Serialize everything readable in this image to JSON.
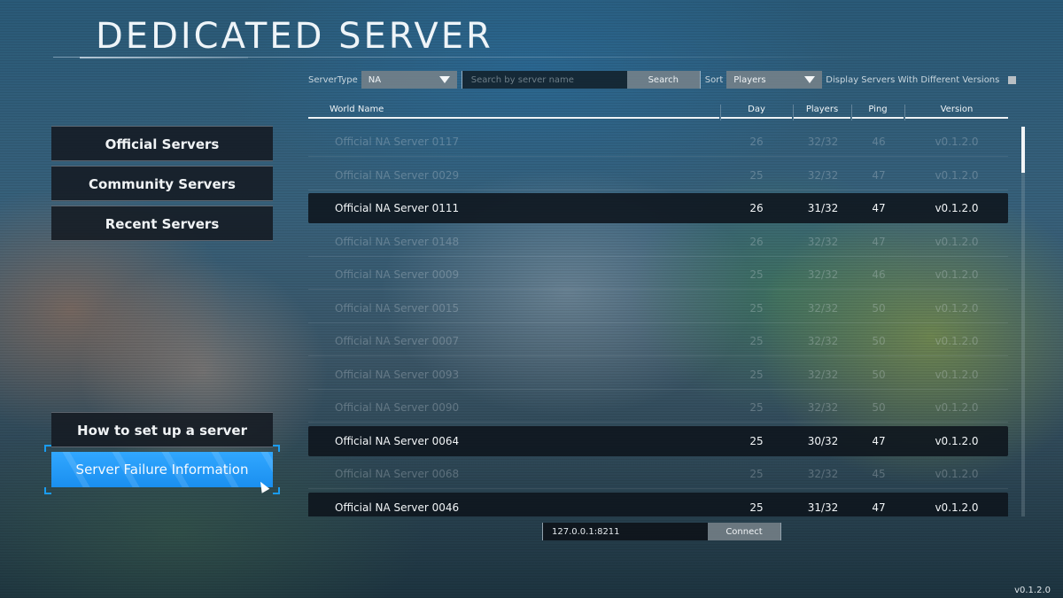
{
  "header": {
    "title": "DEDICATED SERVER"
  },
  "filters": {
    "server_type_label": "ServerType",
    "server_type_value": "NA",
    "search_placeholder": "Search by server name",
    "search_value": "",
    "search_button": "Search",
    "sort_label": "Sort",
    "sort_value": "Players",
    "different_versions_label": "Display Servers With Different Versions",
    "different_versions_checked": false
  },
  "table": {
    "columns": [
      "World Name",
      "Day",
      "Players",
      "Ping",
      "Version"
    ],
    "rows": [
      {
        "name": "Official NA Server 0117",
        "day": "26",
        "players": "32/32",
        "ping": "46",
        "version": "v0.1.2.0",
        "available": false
      },
      {
        "name": "Official NA Server 0029",
        "day": "25",
        "players": "32/32",
        "ping": "47",
        "version": "v0.1.2.0",
        "available": false
      },
      {
        "name": "Official NA Server 0111",
        "day": "26",
        "players": "31/32",
        "ping": "47",
        "version": "v0.1.2.0",
        "available": true
      },
      {
        "name": "Official NA Server 0148",
        "day": "26",
        "players": "32/32",
        "ping": "47",
        "version": "v0.1.2.0",
        "available": false
      },
      {
        "name": "Official NA Server 0009",
        "day": "25",
        "players": "32/32",
        "ping": "46",
        "version": "v0.1.2.0",
        "available": false
      },
      {
        "name": "Official NA Server 0015",
        "day": "25",
        "players": "32/32",
        "ping": "50",
        "version": "v0.1.2.0",
        "available": false
      },
      {
        "name": "Official NA Server 0007",
        "day": "25",
        "players": "32/32",
        "ping": "50",
        "version": "v0.1.2.0",
        "available": false
      },
      {
        "name": "Official NA Server 0093",
        "day": "25",
        "players": "32/32",
        "ping": "50",
        "version": "v0.1.2.0",
        "available": false
      },
      {
        "name": "Official NA Server 0090",
        "day": "25",
        "players": "32/32",
        "ping": "50",
        "version": "v0.1.2.0",
        "available": false
      },
      {
        "name": "Official NA Server 0064",
        "day": "25",
        "players": "30/32",
        "ping": "47",
        "version": "v0.1.2.0",
        "available": true
      },
      {
        "name": "Official NA Server 0068",
        "day": "25",
        "players": "32/32",
        "ping": "45",
        "version": "v0.1.2.0",
        "available": false
      },
      {
        "name": "Official NA Server 0046",
        "day": "25",
        "players": "31/32",
        "ping": "47",
        "version": "v0.1.2.0",
        "available": true
      }
    ]
  },
  "sidebar": {
    "items": [
      {
        "label": "Official Servers"
      },
      {
        "label": "Community Servers"
      },
      {
        "label": "Recent Servers"
      }
    ],
    "help_items": [
      {
        "label": "How to set up a server"
      },
      {
        "label": "Server Failure Information"
      }
    ]
  },
  "connect": {
    "address_value": "127.0.0.1:8211",
    "button": "Connect"
  },
  "footer": {
    "version": "v0.1.2.0"
  },
  "colors": {
    "accent": "#1e96f5"
  }
}
